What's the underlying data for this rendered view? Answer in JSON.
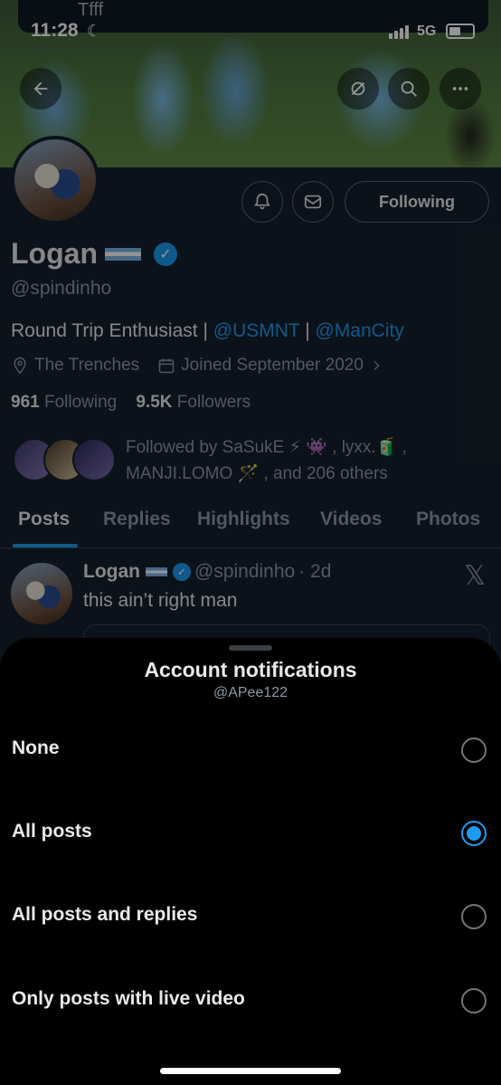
{
  "status_bar": {
    "time": "11:28",
    "moon": "☾",
    "network": "5G",
    "notification_text": "Tfff"
  },
  "profile": {
    "name": "Logan",
    "handle": "@spindinho",
    "bio_text": "Round Trip Enthusiast | ",
    "bio_link1": "@USMNT",
    "bio_sep": " | ",
    "bio_link2": "@ManCity",
    "location": "The Trenches",
    "joined": "Joined September 2020",
    "following_count": "961",
    "following_label": "Following",
    "followers_count": "9.5K",
    "followers_label": "Followers",
    "followed_by": "Followed by SaSukE ⚡ 👾 , lyxx.🧃 , MANJI.LOMO 🪄 , and 206 others",
    "following_button": "Following"
  },
  "tabs": [
    "Posts",
    "Replies",
    "Highlights",
    "Videos",
    "Photos"
  ],
  "post": {
    "name": "Logan",
    "handle": "@spindinho",
    "time": "· 2d",
    "text": "this ain’t right man",
    "x_glyph": "𝕏"
  },
  "sheet": {
    "title": "Account notifications",
    "subtitle": "@APee122",
    "options": [
      {
        "label": "None",
        "selected": false
      },
      {
        "label": "All posts",
        "selected": true
      },
      {
        "label": "All posts and replies",
        "selected": false
      },
      {
        "label": "Only posts with live video",
        "selected": false
      }
    ]
  },
  "colors": {
    "accent": "#1d9bf0",
    "sheet_bg": "#000000",
    "page_bg": "#15202b",
    "muted": "#8b98a5"
  },
  "icons": [
    "back-arrow-icon",
    "tag-off-icon",
    "search-icon",
    "more-icon",
    "bell-icon",
    "mail-icon",
    "location-icon",
    "calendar-icon",
    "chevron-right-icon",
    "verified-icon",
    "x-logo-icon"
  ]
}
